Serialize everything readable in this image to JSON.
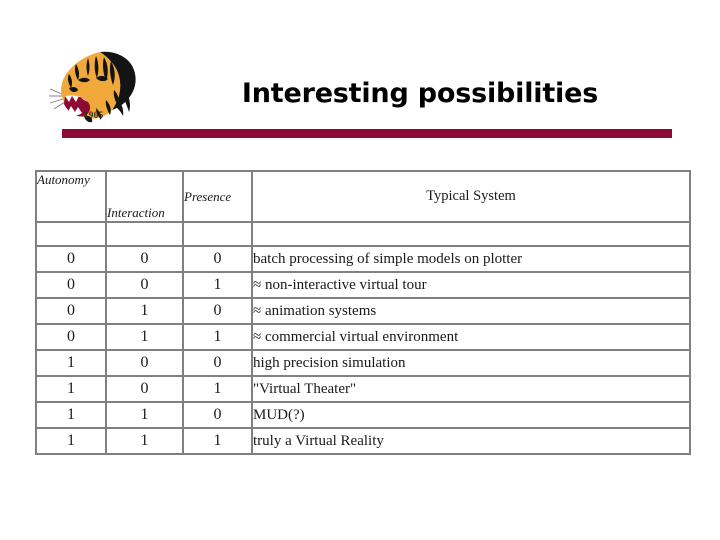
{
  "slide": {
    "title": "Interesting possibilities",
    "accent_color": "#8C0A33",
    "border_color": "#808080",
    "background_color": "#FFFFFF"
  },
  "logo": {
    "name": "tiger-head-logo",
    "year": "1905",
    "fur_color": "#F2A93B",
    "stripe_color": "#1A1A1A",
    "mouth_color": "#8C0A33"
  },
  "table": {
    "headers": {
      "autonomy": "Autonomy",
      "interaction": "Interaction",
      "presence": "Presence",
      "typical_system": "Typical System"
    },
    "rows": [
      {
        "autonomy": "0",
        "interaction": "0",
        "presence": "0",
        "system": "batch processing of simple models on plotter"
      },
      {
        "autonomy": "0",
        "interaction": "0",
        "presence": "1",
        "system": "≈ non-interactive virtual tour"
      },
      {
        "autonomy": "0",
        "interaction": "1",
        "presence": "0",
        "system": "≈ animation systems"
      },
      {
        "autonomy": "0",
        "interaction": "1",
        "presence": "1",
        "system": "≈ commercial virtual environment"
      },
      {
        "autonomy": "1",
        "interaction": "0",
        "presence": "0",
        "system": "high precision simulation"
      },
      {
        "autonomy": "1",
        "interaction": "0",
        "presence": "1",
        "system": "\"Virtual Theater\""
      },
      {
        "autonomy": "1",
        "interaction": "1",
        "presence": "0",
        "system": "MUD(?)"
      },
      {
        "autonomy": "1",
        "interaction": "1",
        "presence": "1",
        "system": "truly a Virtual Reality"
      }
    ]
  }
}
